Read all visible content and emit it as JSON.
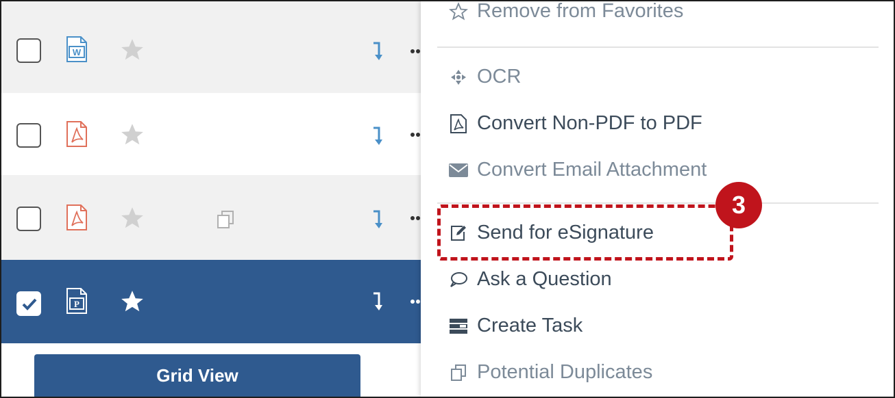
{
  "menu": {
    "items": [
      {
        "label": "Remove from Favorites",
        "icon": "star-outline-icon"
      },
      {
        "label": "OCR",
        "icon": "crosshair-icon"
      },
      {
        "label": "Convert Non-PDF to PDF",
        "icon": "pdf-icon"
      },
      {
        "label": "Convert Email Attachment",
        "icon": "envelope-icon"
      },
      {
        "label": "Send for eSignature",
        "icon": "edit-icon"
      },
      {
        "label": "Ask a Question",
        "icon": "speech-bubble-icon"
      },
      {
        "label": "Create Task",
        "icon": "task-icon"
      },
      {
        "label": "Potential Duplicates",
        "icon": "duplicate-icon"
      }
    ],
    "step_badge": "3"
  },
  "list": {
    "grid_view_label": "Grid View"
  },
  "colors": {
    "selected_row": "#2f5a8f",
    "highlight": "#c0141c"
  }
}
